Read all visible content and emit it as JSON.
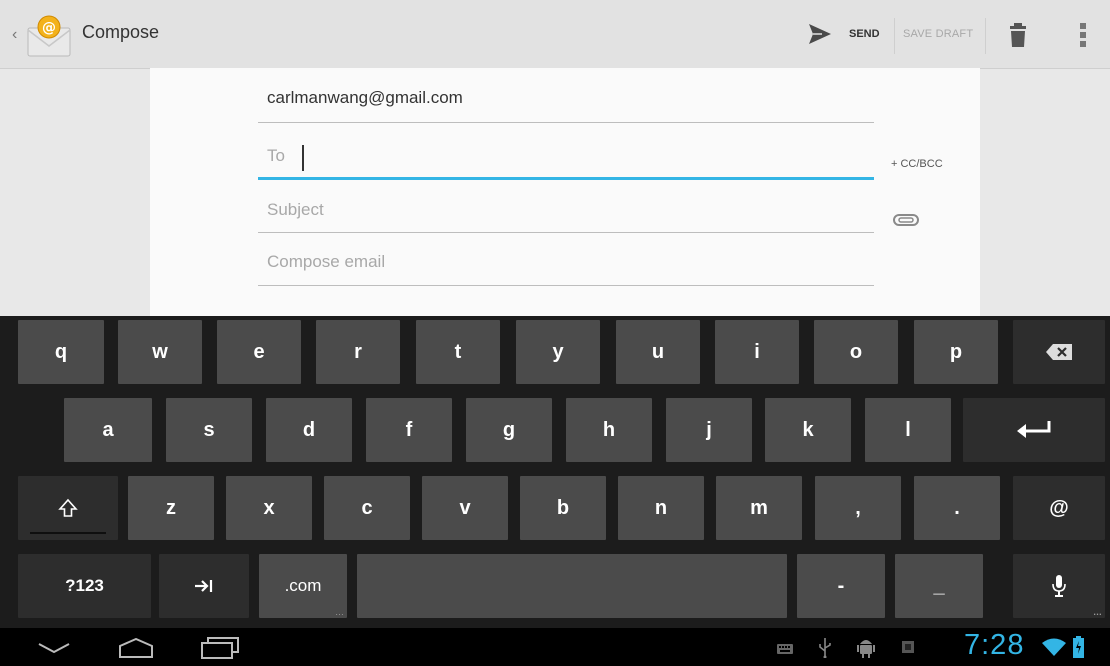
{
  "action_bar": {
    "title": "Compose",
    "send_label": "SEND",
    "save_draft_label": "SAVE DRAFT"
  },
  "compose": {
    "from": "carlmanwang@gmail.com",
    "to_placeholder": "To",
    "cc_bcc_label": "+ CC/BCC",
    "subject_placeholder": "Subject",
    "body_placeholder": "Compose email"
  },
  "keyboard": {
    "row1": [
      "q",
      "w",
      "e",
      "r",
      "t",
      "y",
      "u",
      "i",
      "o",
      "p"
    ],
    "row2": [
      "a",
      "s",
      "d",
      "f",
      "g",
      "h",
      "j",
      "k",
      "l"
    ],
    "row3": [
      "z",
      "x",
      "c",
      "v",
      "b",
      "n",
      "m",
      ",",
      "."
    ],
    "at_key": "@",
    "symbols_key": "?123",
    "dotcom_key": ".com",
    "dash_key": "-",
    "underscore_key": "_"
  },
  "status_bar": {
    "time": "7:28"
  },
  "colors": {
    "accent": "#33b5e5",
    "key": "#4b4b4b",
    "key_dark": "#2d2d2d",
    "keyboard_bg": "#1c1c1c",
    "action_bar_bg": "#e2e2e2"
  },
  "icons": {
    "app": "email-app-icon",
    "send": "send-icon",
    "trash": "trash-icon",
    "overflow": "overflow-menu-icon",
    "attach": "paperclip-icon",
    "backspace": "backspace-icon",
    "enter": "enter-icon",
    "shift": "shift-icon",
    "tab": "tab-icon",
    "mic": "microphone-icon"
  }
}
